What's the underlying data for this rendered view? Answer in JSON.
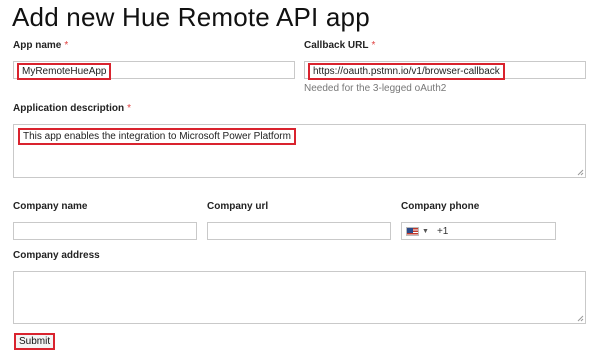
{
  "page": {
    "title": "Add new Hue Remote API app"
  },
  "form": {
    "app_name": {
      "label": "App name",
      "required_mark": "*",
      "value": "MyRemoteHueApp"
    },
    "callback_url": {
      "label": "Callback URL",
      "required_mark": "*",
      "value": "https://oauth.pstmn.io/v1/browser-callback",
      "hint": "Needed for the 3-legged oAuth2"
    },
    "description": {
      "label": "Application description",
      "required_mark": "*",
      "value": "This app enables the integration to Microsoft Power Platform"
    },
    "company_name": {
      "label": "Company name",
      "value": ""
    },
    "company_url": {
      "label": "Company url",
      "value": ""
    },
    "company_phone": {
      "label": "Company phone",
      "country_icon": "us-flag-icon",
      "dial_code": "+1"
    },
    "company_address": {
      "label": "Company address",
      "value": ""
    },
    "submit_label": "Submit"
  },
  "colors": {
    "highlight": "#d9232e",
    "required": "#e0403f",
    "hint": "#777777"
  }
}
